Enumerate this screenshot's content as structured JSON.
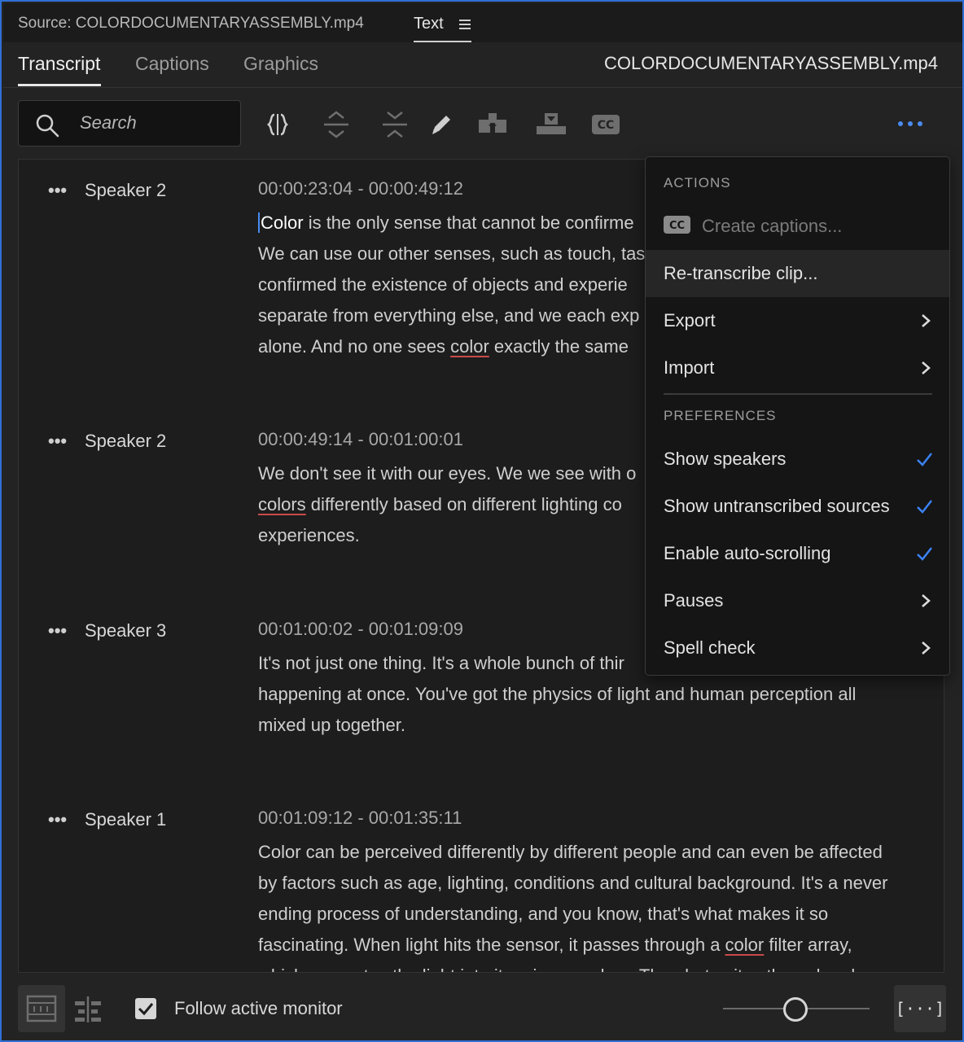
{
  "source_bar": {
    "title": "Source: COLORDOCUMENTARYASSEMBLY.mp4",
    "panel_tab": "Text"
  },
  "tabs": [
    {
      "label": "Transcript",
      "active": true
    },
    {
      "label": "Captions",
      "active": false
    },
    {
      "label": "Graphics",
      "active": false
    }
  ],
  "file_name": "COLORDOCUMENTARYASSEMBLY.mp4",
  "search": {
    "placeholder": "Search"
  },
  "toolbar": {
    "icons": [
      "split-segment-icon",
      "expand-segments-icon",
      "collapse-segments-icon",
      "edit-pencil-icon",
      "insert-icon",
      "overwrite-icon",
      "captions-icon",
      "more-options-icon"
    ]
  },
  "segments": [
    {
      "speaker": "Speaker 2",
      "timecode": "00:00:23:04 - 00:00:49:12",
      "lines": [
        {
          "parts": [
            {
              "t": "Color",
              "cls": "cursor-word"
            },
            {
              "t": " is the only sense that cannot be confirme"
            }
          ]
        },
        {
          "parts": [
            {
              "t": "We can use our other senses, such as touch, tas"
            }
          ]
        },
        {
          "parts": [
            {
              "t": "confirmed the existence of objects and experie"
            }
          ]
        },
        {
          "parts": [
            {
              "t": "separate from everything else, and we each exp"
            }
          ]
        },
        {
          "parts": [
            {
              "t": "alone. And no one sees "
            },
            {
              "t": "color",
              "cls": "u"
            },
            {
              "t": " exactly the same"
            }
          ]
        }
      ]
    },
    {
      "speaker": "Speaker 2",
      "timecode": "00:00:49:14 - 00:01:00:01",
      "lines": [
        {
          "parts": [
            {
              "t": "We don't see it with our eyes. We we see with o"
            }
          ]
        },
        {
          "parts": [
            {
              "t": "colors",
              "cls": "u"
            },
            {
              "t": " differently based on different lighting co"
            }
          ]
        },
        {
          "parts": [
            {
              "t": "experiences."
            }
          ]
        }
      ]
    },
    {
      "speaker": "Speaker 3",
      "timecode": "00:01:00:02 - 00:01:09:09",
      "lines": [
        {
          "parts": [
            {
              "t": "It's not just one thing. It's a whole bunch of thir"
            }
          ]
        },
        {
          "parts": [
            {
              "t": "happening at once. You've got the physics of light and human perception all"
            }
          ]
        },
        {
          "parts": [
            {
              "t": "mixed up together."
            }
          ]
        }
      ]
    },
    {
      "speaker": "Speaker 1",
      "timecode": "00:01:09:12 - 00:01:35:11",
      "lines": [
        {
          "parts": [
            {
              "t": "Color can be perceived differently by different people and can even be affected"
            }
          ]
        },
        {
          "parts": [
            {
              "t": "by factors such as age, lighting, conditions and cultural background. It's a never"
            }
          ]
        },
        {
          "parts": [
            {
              "t": "ending process of understanding, and you know, that's what makes it so"
            }
          ]
        },
        {
          "parts": [
            {
              "t": "fascinating. When light hits the sensor, it passes through a "
            },
            {
              "t": "color",
              "cls": "u"
            },
            {
              "t": " filter array,"
            }
          ]
        },
        {
          "parts": [
            {
              "t": "which separates the light into its primary colors. The photo sites then absorb"
            }
          ]
        }
      ]
    }
  ],
  "menu": {
    "actions_header": "ACTIONS",
    "create_captions": "Create captions...",
    "retranscribe": "Re-transcribe clip...",
    "export": "Export",
    "import": "Import",
    "preferences_header": "PREFERENCES",
    "show_speakers": "Show speakers",
    "show_untranscribed": "Show untranscribed sources",
    "auto_scrolling": "Enable auto-scrolling",
    "pauses": "Pauses",
    "spell_check": "Spell check"
  },
  "bottom": {
    "follow_label": "Follow active monitor",
    "follow_checked": true,
    "expand_label": "[···]"
  },
  "colors": {
    "accent": "#2f6fd6",
    "check": "#3b82f6",
    "underline": "#c94a4a"
  }
}
